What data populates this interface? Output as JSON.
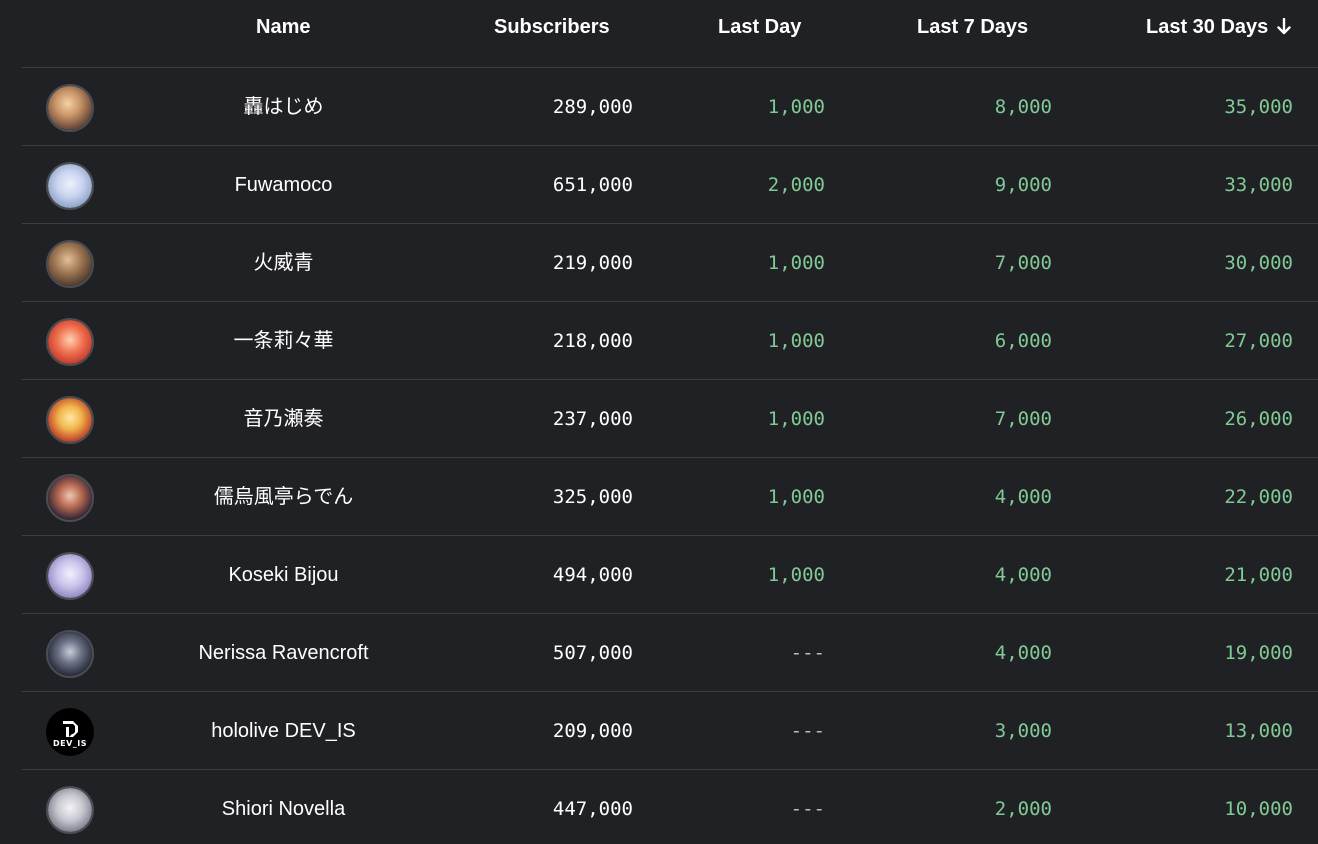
{
  "columns": {
    "name": "Name",
    "subscribers": "Subscribers",
    "last_day": "Last Day",
    "last_7_days": "Last 7 Days",
    "last_30_days": "Last 30 Days",
    "sort_icon": "arrow-down-icon"
  },
  "colors": {
    "background": "#202124",
    "positive": "#81c995",
    "text": "#ffffff",
    "divider": "#3c3e42"
  },
  "rows": [
    {
      "name": "轟はじめ",
      "subscribers": "289,000",
      "last_day": "1,000",
      "last_7_days": "8,000",
      "last_30_days": "35,000",
      "avatar": "avatar-image"
    },
    {
      "name": "Fuwamoco",
      "subscribers": "651,000",
      "last_day": "2,000",
      "last_7_days": "9,000",
      "last_30_days": "33,000",
      "avatar": "avatar-image"
    },
    {
      "name": "火威青",
      "subscribers": "219,000",
      "last_day": "1,000",
      "last_7_days": "7,000",
      "last_30_days": "30,000",
      "avatar": "avatar-image"
    },
    {
      "name": "一条莉々華",
      "subscribers": "218,000",
      "last_day": "1,000",
      "last_7_days": "6,000",
      "last_30_days": "27,000",
      "avatar": "avatar-image"
    },
    {
      "name": "音乃瀬奏",
      "subscribers": "237,000",
      "last_day": "1,000",
      "last_7_days": "7,000",
      "last_30_days": "26,000",
      "avatar": "avatar-image"
    },
    {
      "name": "儒烏風亭らでん",
      "subscribers": "325,000",
      "last_day": "1,000",
      "last_7_days": "4,000",
      "last_30_days": "22,000",
      "avatar": "avatar-image"
    },
    {
      "name": "Koseki Bijou",
      "subscribers": "494,000",
      "last_day": "1,000",
      "last_7_days": "4,000",
      "last_30_days": "21,000",
      "avatar": "avatar-image"
    },
    {
      "name": "Nerissa Ravencroft",
      "subscribers": "507,000",
      "last_day": "---",
      "last_7_days": "4,000",
      "last_30_days": "19,000",
      "avatar": "avatar-image"
    },
    {
      "name": "hololive DEV_IS",
      "subscribers": "209,000",
      "last_day": "---",
      "last_7_days": "3,000",
      "last_30_days": "13,000",
      "avatar": "devis-logo"
    },
    {
      "name": "Shiori Novella",
      "subscribers": "447,000",
      "last_day": "---",
      "last_7_days": "2,000",
      "last_30_days": "10,000",
      "avatar": "avatar-image"
    }
  ]
}
